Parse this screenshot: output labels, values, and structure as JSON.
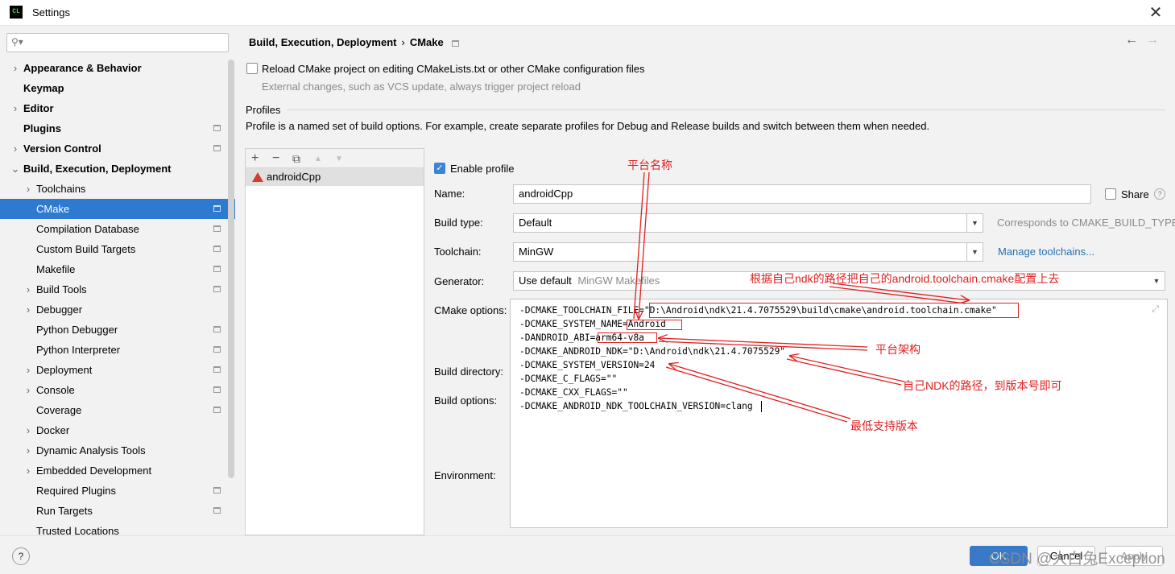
{
  "window": {
    "title": "Settings",
    "app_icon": "CL"
  },
  "search": {
    "placeholder": "",
    "icon": "search-icon"
  },
  "sidebar": {
    "items": [
      {
        "label": "Appearance & Behavior",
        "bold": true,
        "arrow": "›",
        "indent": 0,
        "page_icon": false
      },
      {
        "label": "Keymap",
        "bold": true,
        "arrow": "",
        "indent": 0,
        "page_icon": false
      },
      {
        "label": "Editor",
        "bold": true,
        "arrow": "›",
        "indent": 0,
        "page_icon": false
      },
      {
        "label": "Plugins",
        "bold": true,
        "arrow": "",
        "indent": 0,
        "page_icon": true
      },
      {
        "label": "Version Control",
        "bold": true,
        "arrow": "›",
        "indent": 0,
        "page_icon": true
      },
      {
        "label": "Build, Execution, Deployment",
        "bold": true,
        "arrow": "⌄",
        "indent": 0,
        "page_icon": false
      },
      {
        "label": "Toolchains",
        "bold": false,
        "arrow": "›",
        "indent": 1,
        "page_icon": false
      },
      {
        "label": "CMake",
        "bold": false,
        "arrow": "",
        "indent": 1,
        "page_icon": true,
        "selected": true
      },
      {
        "label": "Compilation Database",
        "bold": false,
        "arrow": "",
        "indent": 1,
        "page_icon": true
      },
      {
        "label": "Custom Build Targets",
        "bold": false,
        "arrow": "",
        "indent": 1,
        "page_icon": true
      },
      {
        "label": "Makefile",
        "bold": false,
        "arrow": "",
        "indent": 1,
        "page_icon": true
      },
      {
        "label": "Build Tools",
        "bold": false,
        "arrow": "›",
        "indent": 1,
        "page_icon": true
      },
      {
        "label": "Debugger",
        "bold": false,
        "arrow": "›",
        "indent": 1,
        "page_icon": false
      },
      {
        "label": "Python Debugger",
        "bold": false,
        "arrow": "",
        "indent": 1,
        "page_icon": true
      },
      {
        "label": "Python Interpreter",
        "bold": false,
        "arrow": "",
        "indent": 1,
        "page_icon": true
      },
      {
        "label": "Deployment",
        "bold": false,
        "arrow": "›",
        "indent": 1,
        "page_icon": true
      },
      {
        "label": "Console",
        "bold": false,
        "arrow": "›",
        "indent": 1,
        "page_icon": true
      },
      {
        "label": "Coverage",
        "bold": false,
        "arrow": "",
        "indent": 1,
        "page_icon": true
      },
      {
        "label": "Docker",
        "bold": false,
        "arrow": "›",
        "indent": 1,
        "page_icon": false
      },
      {
        "label": "Dynamic Analysis Tools",
        "bold": false,
        "arrow": "›",
        "indent": 1,
        "page_icon": false
      },
      {
        "label": "Embedded Development",
        "bold": false,
        "arrow": "›",
        "indent": 1,
        "page_icon": false
      },
      {
        "label": "Required Plugins",
        "bold": false,
        "arrow": "",
        "indent": 1,
        "page_icon": true
      },
      {
        "label": "Run Targets",
        "bold": false,
        "arrow": "",
        "indent": 1,
        "page_icon": true
      },
      {
        "label": "Trusted Locations",
        "bold": false,
        "arrow": "",
        "indent": 1,
        "page_icon": false
      }
    ]
  },
  "header": {
    "crumb1": "Build, Execution, Deployment",
    "crumb_sep": "›",
    "crumb2": "CMake",
    "back_icon": "←",
    "forward_icon": "→"
  },
  "reload": {
    "label": "Reload CMake project on editing CMakeLists.txt or other CMake configuration files",
    "hint": "External changes, such as VCS update, always trigger project reload",
    "checked": false
  },
  "profiles": {
    "section_title": "Profiles",
    "description": "Profile is a named set of build options. For example, create separate profiles for Debug and Release builds and switch between them when needed.",
    "toolbar": {
      "add": "+",
      "remove": "−",
      "copy": "⧉",
      "up": "▲",
      "down": "▼"
    },
    "items": [
      "androidCpp"
    ]
  },
  "form": {
    "enable_profile_label": "Enable profile",
    "enable_profile_checked": true,
    "name_label": "Name:",
    "name_value": "androidCpp",
    "share_label": "Share",
    "help_glyph": "?",
    "build_type_label": "Build type:",
    "build_type_value": "Default",
    "build_type_hint": "Corresponds to CMAKE_BUILD_TYPE",
    "toolchain_label": "Toolchain:",
    "toolchain_value": "MinGW",
    "manage_toolchains": "Manage toolchains...",
    "generator_label": "Generator:",
    "generator_value": "Use default",
    "generator_hint": "MinGW Makefiles",
    "cmake_options_label": "CMake options:",
    "build_directory_label": "Build directory:",
    "build_options_label": "Build options:",
    "environment_label": "Environment:",
    "dropdown_glyph": "▼",
    "expand_icon": "⤢"
  },
  "cmake_options": {
    "lines": [
      "-DCMAKE_TOOLCHAIN_FILE=\"D:\\Android\\ndk\\21.4.7075529\\build\\cmake\\android.toolchain.cmake\"",
      "-DCMAKE_SYSTEM_NAME=Android",
      "-DANDROID_ABI=arm64-v8a",
      "-DCMAKE_ANDROID_NDK=\"D:\\Android\\ndk\\21.4.7075529\"",
      "-DCMAKE_SYSTEM_VERSION=24",
      "-DCMAKE_C_FLAGS=\"\"",
      "-DCMAKE_CXX_FLAGS=\"\"",
      "-DCMAKE_ANDROID_NDK_TOOLCHAIN_VERSION=clang"
    ]
  },
  "annotations": {
    "platform_name": "平台名称",
    "toolchain_note": "根据自己ndk的路径把自己的android.toolchain.cmake配置上去",
    "platform_arch": "平台架构",
    "ndk_path": "自己NDK的路径，到版本号即可",
    "min_version": "最低支持版本",
    "color": "#e02020"
  },
  "footer": {
    "help": "?",
    "ok": "OK",
    "cancel": "Cancel",
    "apply": "Apply",
    "watermark": "CSDN @大白兔Exception"
  }
}
